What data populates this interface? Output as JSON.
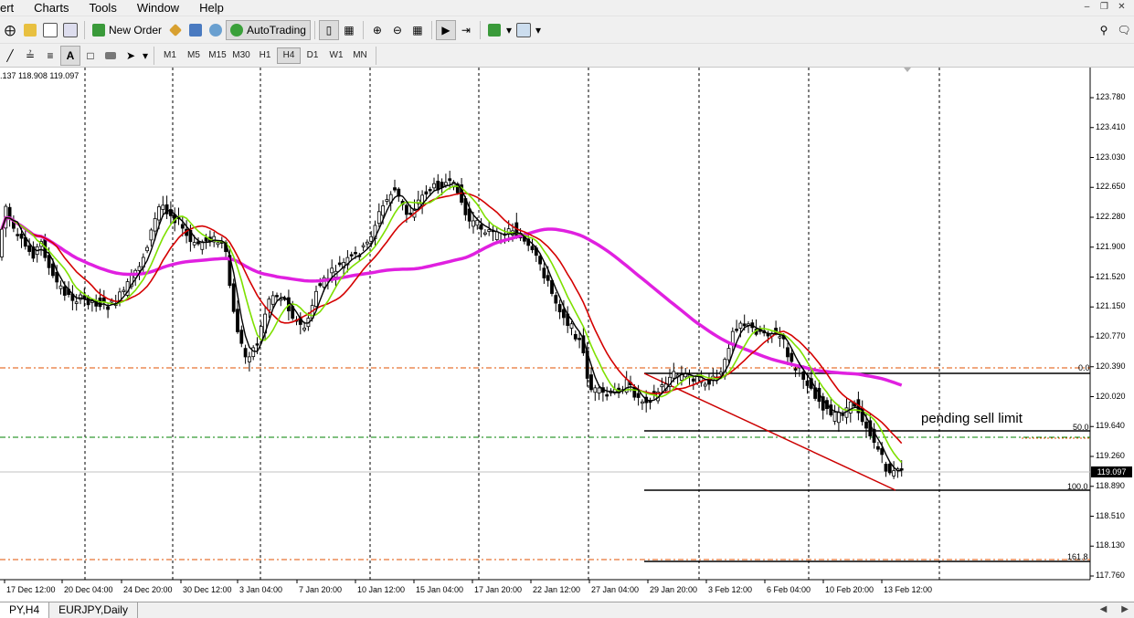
{
  "menu": [
    "ert",
    "Charts",
    "Tools",
    "Window",
    "Help"
  ],
  "window_controls": [
    "minimize",
    "restore",
    "close"
  ],
  "toolbar": {
    "new_order_label": "New Order",
    "autotrading_label": "AutoTrading",
    "timeframes": [
      "M1",
      "M5",
      "M15",
      "M30",
      "H1",
      "H4",
      "D1",
      "W1",
      "MN"
    ],
    "active_timeframe": "H4"
  },
  "chart": {
    "ohlc_text": ".137 118.908 119.097",
    "current_price": "119.097",
    "price_labels": [
      "123.780",
      "123.410",
      "123.030",
      "122.650",
      "122.280",
      "121.900",
      "121.520",
      "121.150",
      "120.770",
      "120.390",
      "120.020",
      "119.640",
      "119.260",
      "118.890",
      "118.510",
      "118.130",
      "117.760"
    ],
    "time_labels": [
      "17 Dec 12:00",
      "20 Dec 04:00",
      "24 Dec 20:00",
      "30 Dec 12:00",
      "3 Jan 04:00",
      "7 Jan 20:00",
      "10 Jan 12:00",
      "15 Jan 04:00",
      "17 Jan 20:00",
      "22 Jan 12:00",
      "27 Jan 04:00",
      "29 Jan 20:00",
      "3 Feb 12:00",
      "6 Feb 04:00",
      "10 Feb 20:00",
      "13 Feb 12:00"
    ],
    "fib_labels": {
      "level_0": "0.0",
      "level_50": "50.0",
      "level_100": "100.0",
      "level_161": "161.8"
    },
    "annotation": "pending sell limit",
    "colors": {
      "ma_fast": "#000000",
      "ma_green": "#7ee000",
      "ma_red": "#d40000",
      "ma_magenta": "#e020e0",
      "fib_line": "#000000",
      "trend_line": "#cc0000",
      "orange_dash": "#e05000",
      "green_dash": "#008000"
    }
  },
  "tabs": [
    "PY,H4",
    "EURJPY,Daily"
  ]
}
